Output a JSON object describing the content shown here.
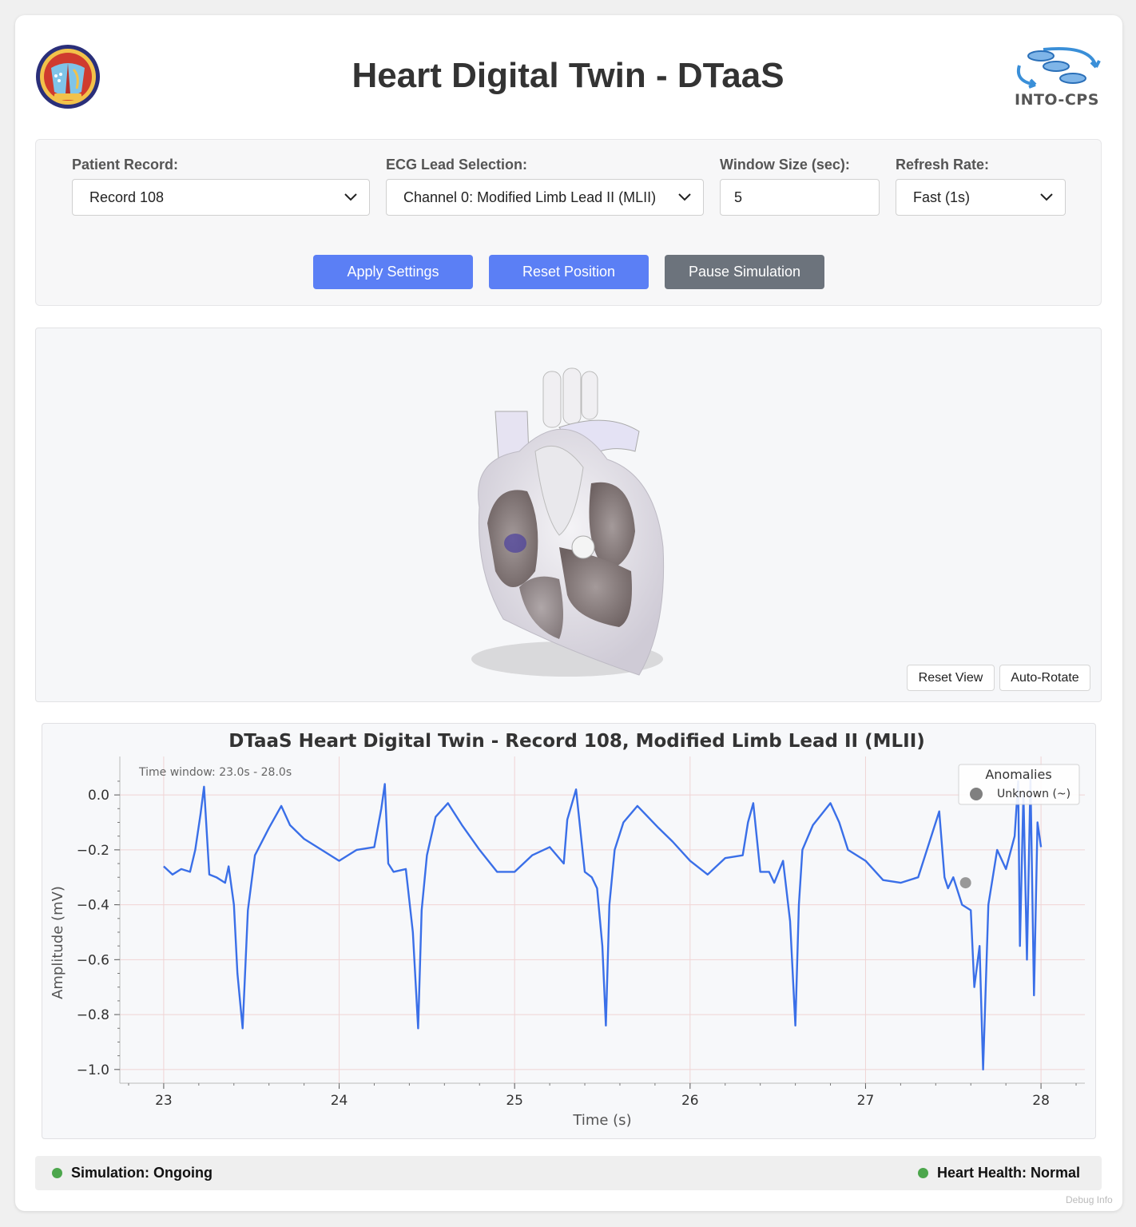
{
  "header": {
    "title": "Heart Digital Twin - DTaaS",
    "right_logo_text": "INTO-CPS"
  },
  "controls": {
    "patient_record": {
      "label": "Patient Record:",
      "value": "Record 108"
    },
    "ecg_lead": {
      "label": "ECG Lead Selection:",
      "value": "Channel 0: Modified Limb Lead II (MLII)"
    },
    "window_size": {
      "label": "Window Size (sec):",
      "value": "5"
    },
    "refresh_rate": {
      "label": "Refresh Rate:",
      "value": "Fast (1s)"
    },
    "buttons": {
      "apply": "Apply Settings",
      "reset_position": "Reset Position",
      "pause": "Pause Simulation"
    }
  },
  "viewer": {
    "reset_view": "Reset View",
    "auto_rotate": "Auto-Rotate"
  },
  "status": {
    "simulation": "Simulation: Ongoing",
    "heart_health": "Heart Health: Normal",
    "debug": "Debug Info",
    "indicator_color": "#4ca64c"
  },
  "chart_data": {
    "type": "line",
    "title": "DTaaS Heart Digital Twin - Record 108, Modified Limb Lead II (MLII)",
    "xlabel": "Time (s)",
    "ylabel": "Amplitude (mV)",
    "annotation": "Time window: 23.0s - 28.0s",
    "xlim": [
      22.75,
      28.25
    ],
    "ylim": [
      -1.05,
      0.14
    ],
    "xticks": [
      "23",
      "24",
      "25",
      "26",
      "27",
      "28"
    ],
    "yticks": [
      "0.0",
      "−0.2",
      "−0.4",
      "−0.6",
      "−0.8",
      "−1.0"
    ],
    "grid": true,
    "line_color": "#3a6fe8",
    "legend": {
      "title": "Anomalies",
      "placement": "top-right",
      "entries": [
        {
          "label": "Unknown (~)",
          "color": "#808080"
        }
      ]
    },
    "anomaly_points": [
      {
        "x": 27.57,
        "y": -0.32
      }
    ],
    "series": [
      {
        "x": [
          23.0,
          23.05,
          23.1,
          23.15,
          23.18,
          23.21,
          23.23,
          23.26,
          23.3,
          23.35,
          23.37,
          23.4,
          23.42,
          23.45,
          23.48,
          23.52,
          23.6,
          23.67,
          23.72,
          23.8,
          23.9,
          24.0,
          24.1,
          24.2,
          24.24,
          24.26,
          24.28,
          24.31,
          24.38,
          24.42,
          24.45,
          24.47,
          24.5,
          24.55,
          24.62,
          24.7,
          24.8,
          24.9,
          25.0,
          25.1,
          25.2,
          25.28,
          25.3,
          25.35,
          25.4,
          25.44,
          25.47,
          25.5,
          25.52,
          25.54,
          25.57,
          25.62,
          25.7,
          25.82,
          25.9,
          26.0,
          26.1,
          26.2,
          26.3,
          26.33,
          26.36,
          26.4,
          26.45,
          26.48,
          26.53,
          26.57,
          26.6,
          26.62,
          26.64,
          26.7,
          26.8,
          26.85,
          26.9,
          27.0,
          27.1,
          27.2,
          27.3,
          27.38,
          27.42,
          27.45,
          27.47,
          27.5,
          27.55,
          27.6,
          27.62,
          27.65,
          27.67,
          27.7,
          27.75,
          27.8,
          27.85,
          27.87,
          27.88,
          27.9,
          27.92,
          27.94,
          27.96,
          27.98,
          28.0
        ],
        "values": [
          -0.26,
          -0.29,
          -0.27,
          -0.28,
          -0.2,
          -0.07,
          0.03,
          -0.29,
          -0.3,
          -0.32,
          -0.26,
          -0.4,
          -0.65,
          -0.85,
          -0.42,
          -0.22,
          -0.12,
          -0.04,
          -0.11,
          -0.16,
          -0.2,
          -0.24,
          -0.2,
          -0.19,
          -0.05,
          0.04,
          -0.25,
          -0.28,
          -0.27,
          -0.5,
          -0.85,
          -0.42,
          -0.22,
          -0.08,
          -0.03,
          -0.11,
          -0.2,
          -0.28,
          -0.28,
          -0.22,
          -0.19,
          -0.25,
          -0.09,
          0.02,
          -0.28,
          -0.3,
          -0.34,
          -0.55,
          -0.84,
          -0.4,
          -0.2,
          -0.1,
          -0.04,
          -0.12,
          -0.17,
          -0.24,
          -0.29,
          -0.23,
          -0.22,
          -0.1,
          -0.03,
          -0.28,
          -0.28,
          -0.32,
          -0.24,
          -0.46,
          -0.84,
          -0.4,
          -0.2,
          -0.11,
          -0.03,
          -0.1,
          -0.2,
          -0.24,
          -0.31,
          -0.32,
          -0.3,
          -0.14,
          -0.06,
          -0.3,
          -0.34,
          -0.3,
          -0.4,
          -0.42,
          -0.7,
          -0.55,
          -1.0,
          -0.4,
          -0.2,
          -0.27,
          -0.15,
          0.05,
          -0.55,
          0.01,
          -0.6,
          0.06,
          -0.73,
          -0.1,
          -0.19
        ]
      }
    ]
  }
}
